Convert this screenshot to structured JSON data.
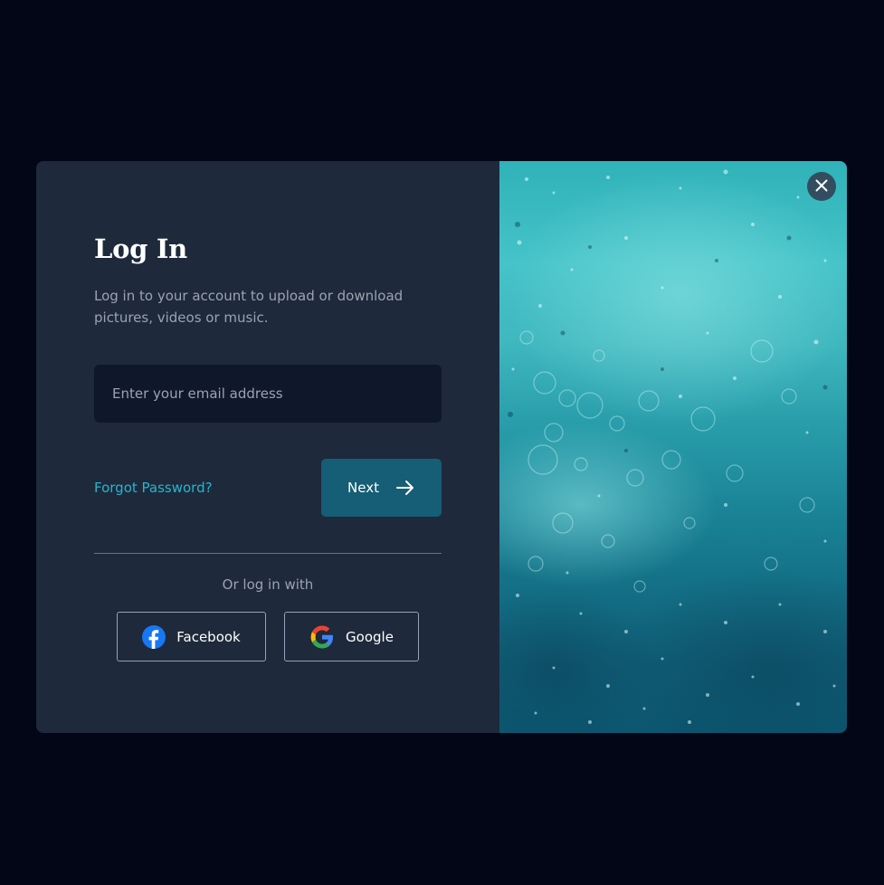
{
  "login": {
    "title": "Log In",
    "subtitle": "Log in to your account to upload or download pictures, videos or music.",
    "email_placeholder": "Enter your email address",
    "email_value": "",
    "forgot_password": "Forgot Password?",
    "next_label": "Next",
    "or_text": "Or log in with",
    "facebook_label": "Facebook",
    "google_label": "Google"
  },
  "icons": {
    "next": "arrow-right-icon",
    "facebook": "facebook-icon",
    "google": "google-icon",
    "close": "close-icon"
  },
  "colors": {
    "page_background": "#020617",
    "panel_background": "#1e293b",
    "input_background": "#0f172a",
    "accent_link": "#22b8cf",
    "next_button": "#155e75",
    "facebook_blue": "#1877f2"
  }
}
